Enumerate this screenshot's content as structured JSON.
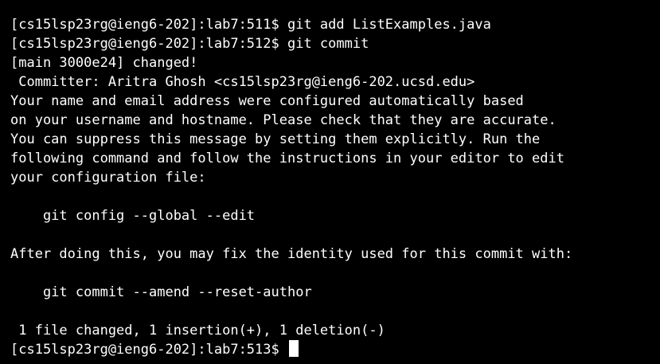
{
  "terminal": {
    "colors": {
      "background": "#000000",
      "foreground": "#ffffff",
      "cursor": "#ffffff"
    },
    "lines": [
      "[cs15lsp23rg@ieng6-202]:lab7:511$ git add ListExamples.java",
      "[cs15lsp23rg@ieng6-202]:lab7:512$ git commit",
      "[main 3000e24] changed!",
      " Committer: Aritra Ghosh <cs15lsp23rg@ieng6-202.ucsd.edu>",
      "Your name and email address were configured automatically based",
      "on your username and hostname. Please check that they are accurate.",
      "You can suppress this message by setting them explicitly. Run the",
      "following command and follow the instructions in your editor to edit",
      "your configuration file:",
      "",
      "    git config --global --edit",
      "",
      "After doing this, you may fix the identity used for this commit with:",
      "",
      "    git commit --amend --reset-author",
      "",
      " 1 file changed, 1 insertion(+), 1 deletion(-)"
    ],
    "prompt": "[cs15lsp23rg@ieng6-202]:lab7:513$ "
  }
}
